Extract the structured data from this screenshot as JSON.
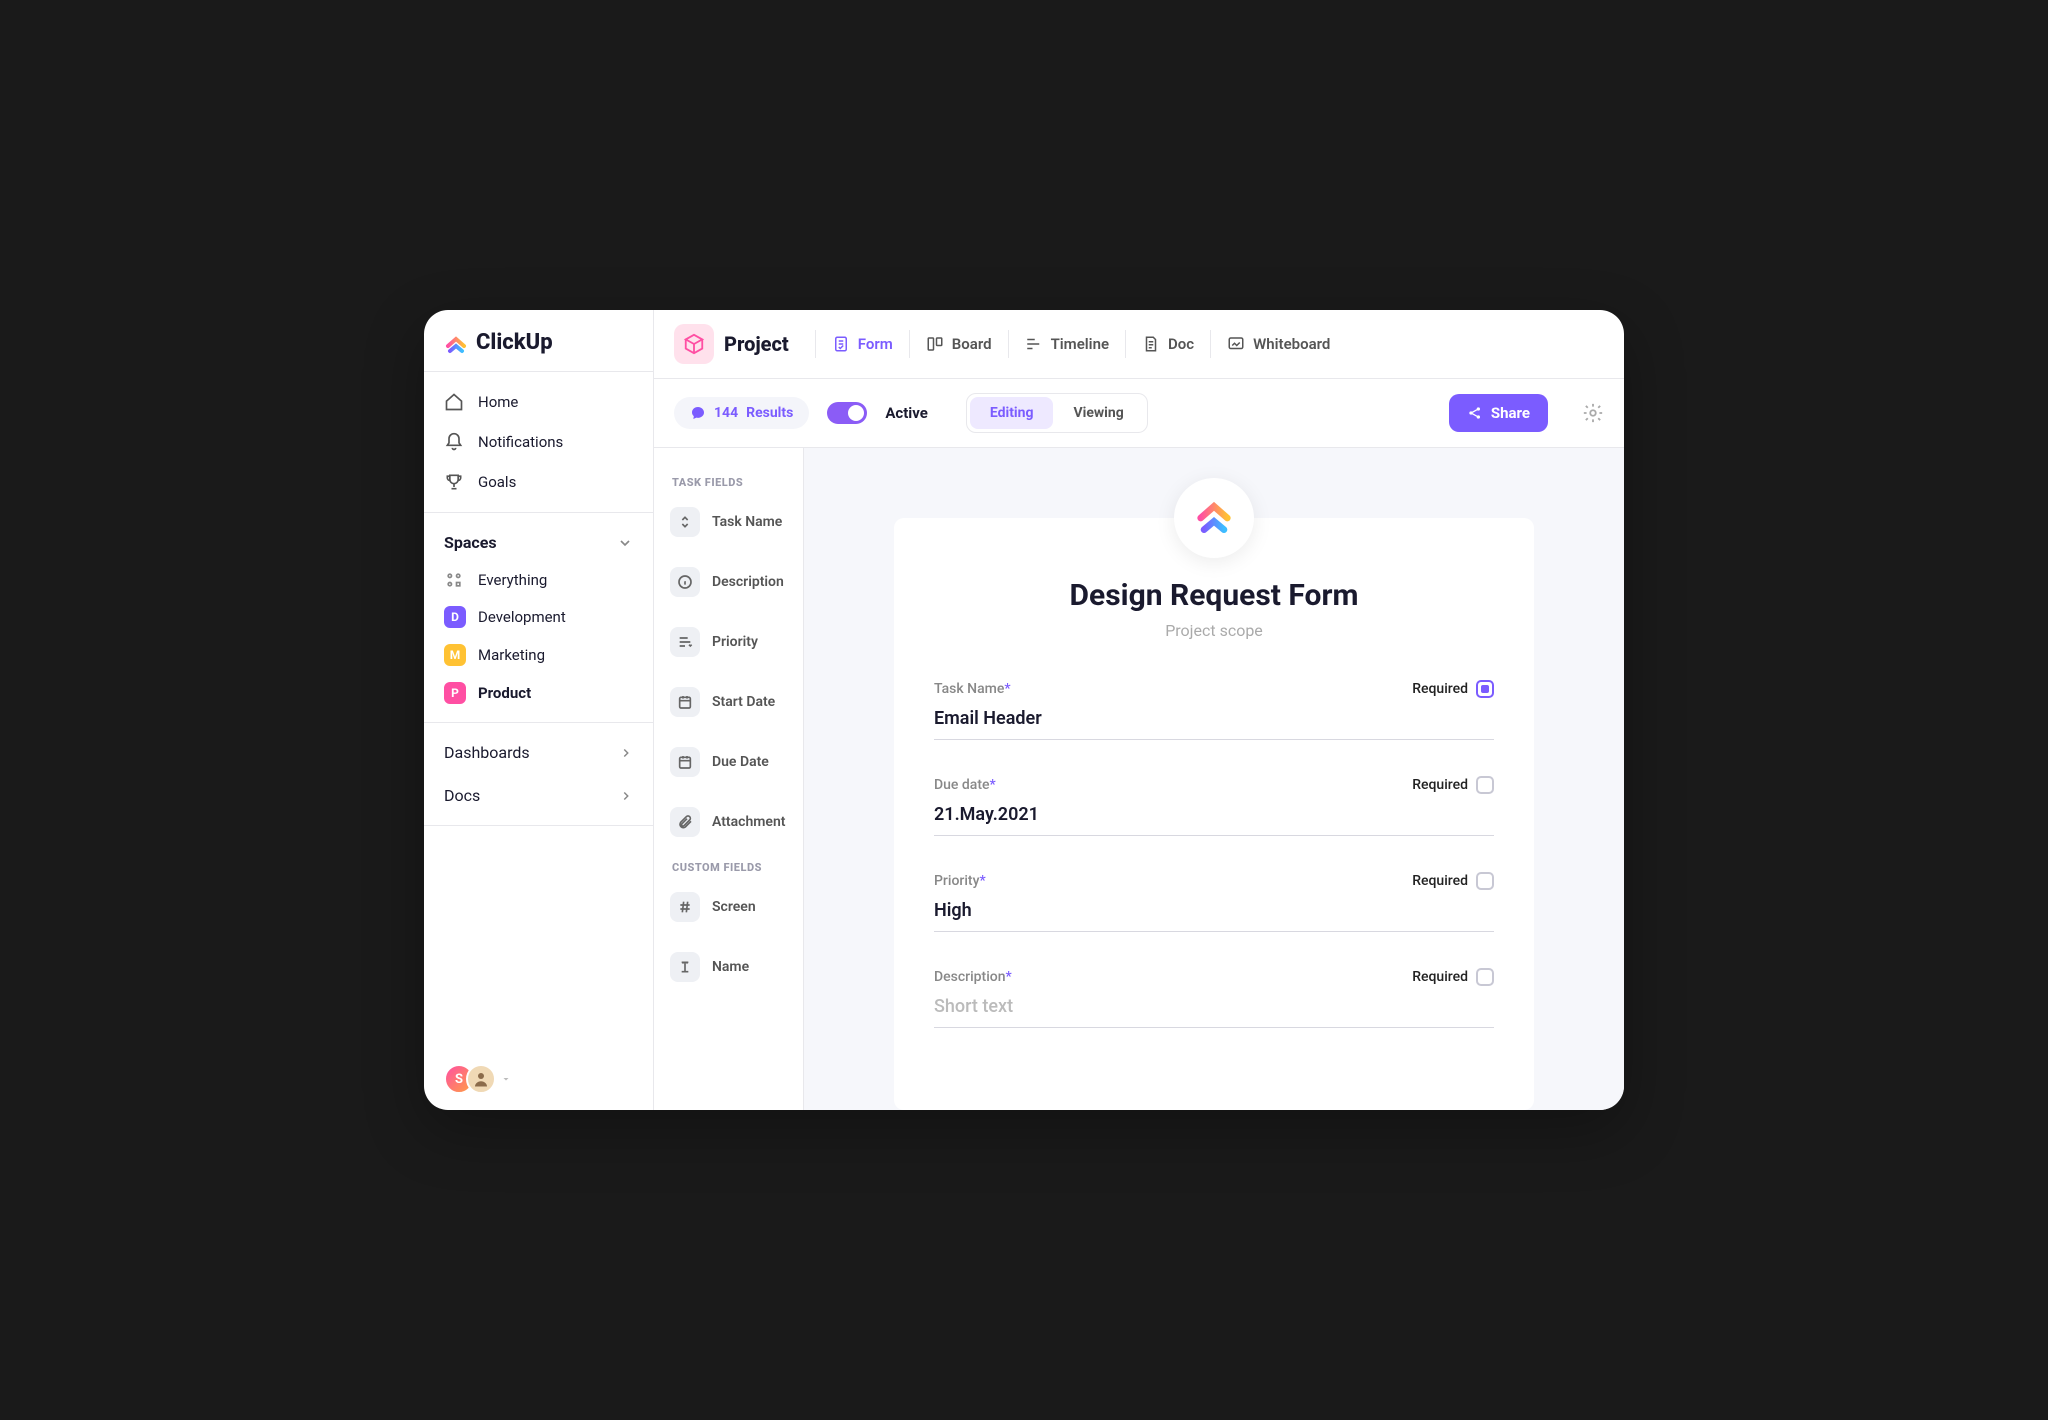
{
  "brand": {
    "name": "ClickUp"
  },
  "sidebar": {
    "nav": [
      {
        "label": "Home"
      },
      {
        "label": "Notifications"
      },
      {
        "label": "Goals"
      }
    ],
    "spaces_header": "Spaces",
    "everything_label": "Everything",
    "spaces": [
      {
        "letter": "D",
        "label": "Development",
        "color": "#7b5cff"
      },
      {
        "letter": "M",
        "label": "Marketing",
        "color": "#ffc233"
      },
      {
        "letter": "P",
        "label": "Product",
        "color": "#ff4fa3",
        "selected": true
      }
    ],
    "sections": [
      {
        "label": "Dashboards"
      },
      {
        "label": "Docs"
      }
    ],
    "avatars": [
      {
        "letter": "S",
        "bg": "linear-gradient(135deg,#ff4fa3,#ff9f43)"
      }
    ]
  },
  "header": {
    "project_label": "Project",
    "views": [
      {
        "label": "Form",
        "active": true
      },
      {
        "label": "Board",
        "active": false
      },
      {
        "label": "Timeline",
        "active": false
      },
      {
        "label": "Doc",
        "active": false
      },
      {
        "label": "Whiteboard",
        "active": false
      }
    ]
  },
  "toolbar": {
    "results_count": "144",
    "results_label": "Results",
    "active_label": "Active",
    "active_on": true,
    "segments": [
      {
        "label": "Editing",
        "active": true
      },
      {
        "label": "Viewing",
        "active": false
      }
    ],
    "share_label": "Share"
  },
  "fields_panel": {
    "task_fields_heading": "TASK FIELDS",
    "task_fields": [
      {
        "label": "Task Name"
      },
      {
        "label": "Description"
      },
      {
        "label": "Priority"
      },
      {
        "label": "Start Date"
      },
      {
        "label": "Due Date"
      },
      {
        "label": "Attachment"
      }
    ],
    "custom_fields_heading": "CUSTOM FIELDS",
    "custom_fields": [
      {
        "label": "Screen"
      },
      {
        "label": "Name"
      }
    ]
  },
  "form": {
    "title": "Design Request Form",
    "subtitle": "Project scope",
    "required_label": "Required",
    "fields": [
      {
        "label": "Task Name",
        "value": "Email Header",
        "required_checked": true,
        "placeholder": false
      },
      {
        "label": "Due date",
        "value": "21.May.2021",
        "required_checked": false,
        "placeholder": false
      },
      {
        "label": "Priority",
        "value": "High",
        "required_checked": false,
        "placeholder": false
      },
      {
        "label": "Description",
        "value": "Short text",
        "required_checked": false,
        "placeholder": true
      }
    ]
  }
}
